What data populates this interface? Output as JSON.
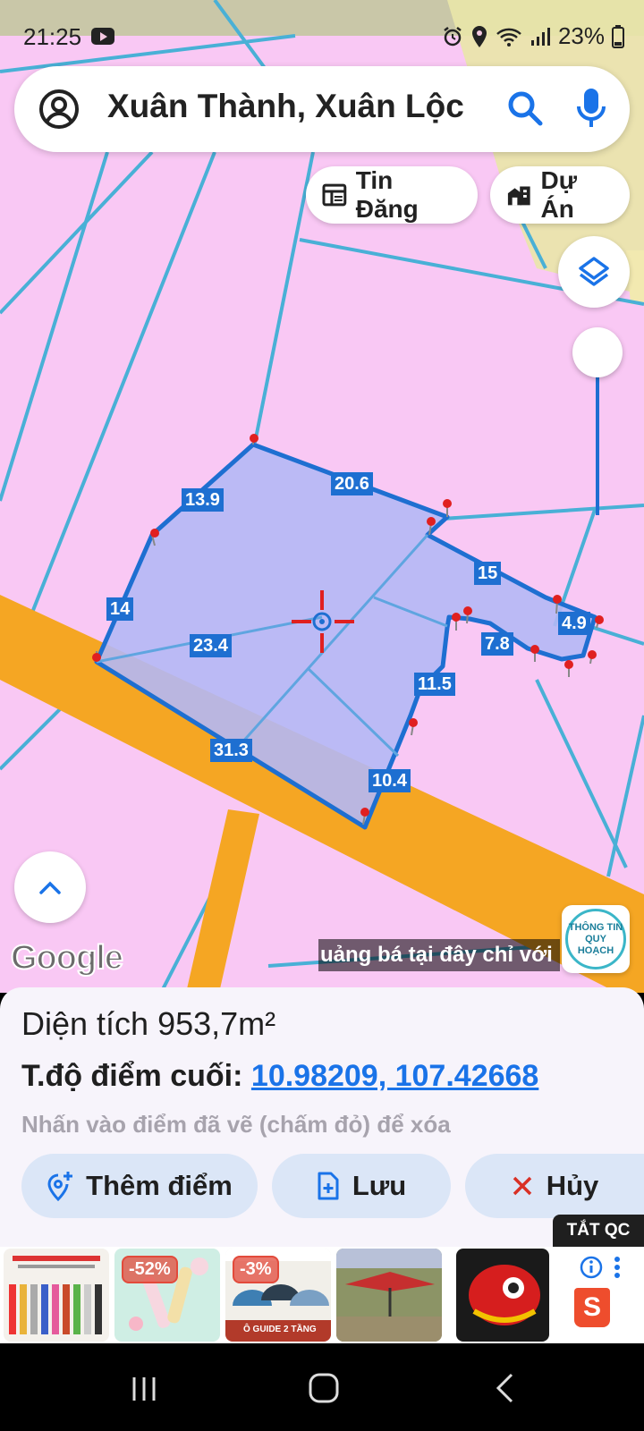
{
  "status_bar": {
    "time": "21:25",
    "battery": "23%"
  },
  "search": {
    "query": "Xuân Thành, Xuân Lộc"
  },
  "chips": {
    "listings": "Tin Đăng",
    "projects": "Dự Án"
  },
  "map": {
    "edge_labels": [
      "13.9",
      "20.6",
      "15",
      "4.9",
      "7.8",
      "11.5",
      "10.4",
      "31.3",
      "14",
      "23.4"
    ],
    "watermark": "Google",
    "ad_ticker": "uảng bá tại đây chỉ với",
    "planning_button": [
      "THÔNG TIN",
      "QUY HOẠCH"
    ]
  },
  "panel": {
    "area_label": "Diện tích",
    "area_value": "953,7m²",
    "coord_label": "T.độ điểm cuối:",
    "coord_value": "10.98209, 107.42668",
    "hint": "Nhấn vào điểm đã vẽ (chấm đỏ) để xóa",
    "add_point": "Thêm điểm",
    "save": "Lưu",
    "cancel": "Hủy"
  },
  "ads": {
    "hide_ads": "TẮT QC",
    "badges": [
      "-52%",
      "-3%"
    ],
    "thumb3_caption": "Ô GUIDE 2 TẦNG",
    "shopee_letter": "S"
  },
  "colors": {
    "map_base": "#f9c8f4",
    "plot_fill": "#b4b8f5",
    "plot_border": "#1e6fd1",
    "road": "#f5a623",
    "accent": "#1a73e8",
    "button_bg": "#dbe6f7"
  }
}
